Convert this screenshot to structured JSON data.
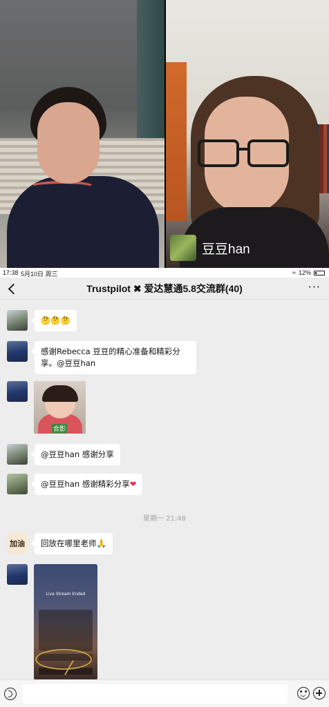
{
  "video": {
    "participant_right_name": "豆豆han"
  },
  "status_bar": {
    "time": "17:38",
    "date": "5月10日 周三",
    "battery": "12%"
  },
  "nav": {
    "title": "Trustpilot ✖ 爱达慧通5.8交流群(40)",
    "more": "···"
  },
  "messages": [
    {
      "type": "text",
      "text": "🤔🤔🤔"
    },
    {
      "type": "text",
      "text": "感谢Rebecca 豆豆的精心准备和精彩分享。@豆豆han"
    },
    {
      "type": "image",
      "tag": "合影"
    },
    {
      "type": "text",
      "text": "@豆豆han  感谢分享"
    },
    {
      "type": "text",
      "text": "@豆豆han 感谢精彩分享",
      "emoji": "❤"
    },
    {
      "type": "time",
      "text": "星期一 21:48"
    },
    {
      "type": "text",
      "text": "回放在哪里老师",
      "emoji": "🙏"
    },
    {
      "type": "screenshot",
      "header": "Live Stream Ended"
    }
  ],
  "avatars": {
    "d_label": "加油"
  },
  "input": {
    "placeholder": ""
  }
}
